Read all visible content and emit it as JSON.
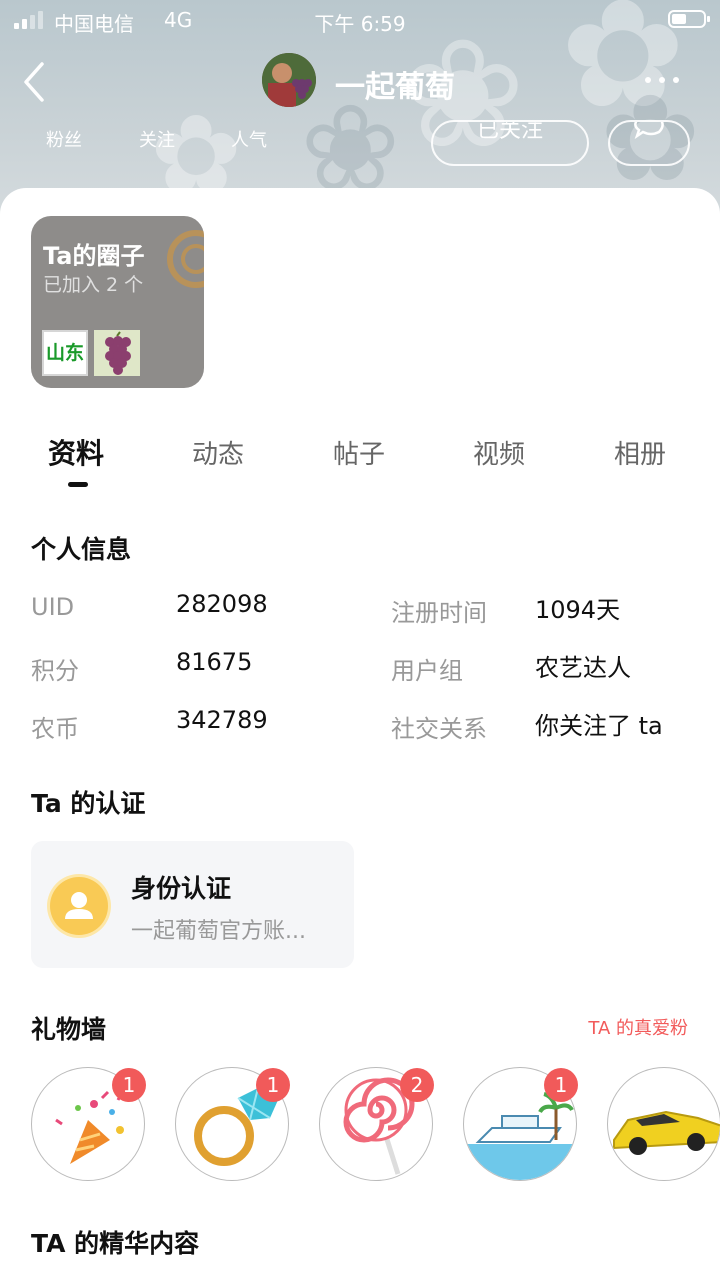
{
  "status": {
    "carrier": "中国电信",
    "network": "4G",
    "time": "下午 6:59"
  },
  "profile": {
    "name": "一起葡萄"
  },
  "stats": {
    "fans": "粉丝",
    "follow": "关注",
    "popularity": "人气"
  },
  "buttons": {
    "follow_state": "已关注"
  },
  "circles": {
    "title": "Ta的圈子",
    "subtitle": "已加入 2 个",
    "tag1": "山东"
  },
  "tabs": [
    "资料",
    "动态",
    "帖子",
    "视频",
    "相册"
  ],
  "info": {
    "title": "个人信息",
    "left": [
      {
        "label": "UID",
        "value": "282098"
      },
      {
        "label": "积分",
        "value": "81675"
      },
      {
        "label": "农币",
        "value": "342789"
      }
    ],
    "right": [
      {
        "label": "注册时间",
        "value": "1094天"
      },
      {
        "label": "用户组",
        "value": "农艺达人"
      },
      {
        "label": "社交关系",
        "value": "你关注了 ta"
      }
    ]
  },
  "auth": {
    "title": "Ta 的认证",
    "card_title": "身份认证",
    "card_sub": "一起葡萄官方账..."
  },
  "gifts": {
    "title": "礼物墙",
    "link": "TA 的真爱粉",
    "items": [
      {
        "icon": "party-popper-icon",
        "count": "1"
      },
      {
        "icon": "diamond-ring-icon",
        "count": "1"
      },
      {
        "icon": "lollipop-icon",
        "count": "2"
      },
      {
        "icon": "yacht-icon",
        "count": "1"
      },
      {
        "icon": "sports-car-icon",
        "count": ""
      }
    ]
  },
  "featured": {
    "title": "TA 的精华内容"
  },
  "colors": {
    "accent": "#f25b5b",
    "badge": "#f15a5a",
    "auth_icon": "#f9ca55"
  }
}
